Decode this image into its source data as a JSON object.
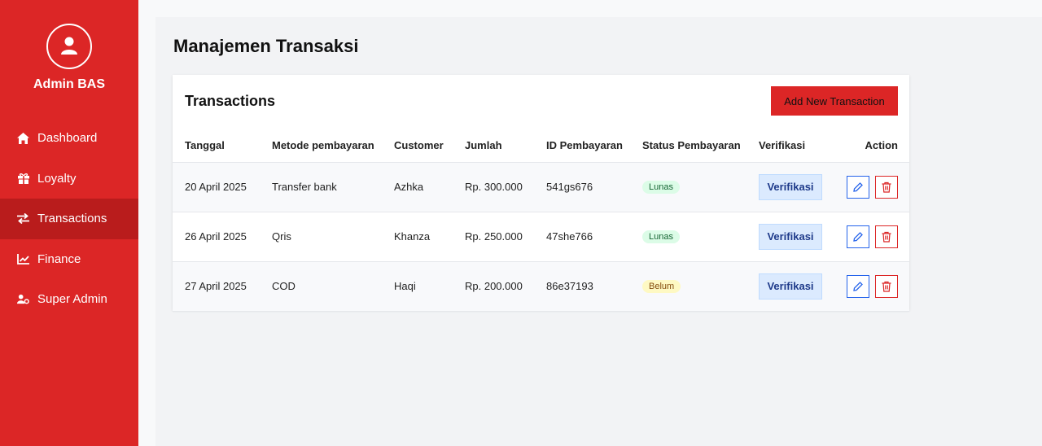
{
  "sidebar": {
    "admin_name": "Admin BAS",
    "items": [
      {
        "label": "Dashboard",
        "icon": "home-icon",
        "active": false
      },
      {
        "label": "Loyalty",
        "icon": "gift-icon",
        "active": false
      },
      {
        "label": "Transactions",
        "icon": "exchange-icon",
        "active": true
      },
      {
        "label": "Finance",
        "icon": "chart-line-icon",
        "active": false
      },
      {
        "label": "Super Admin",
        "icon": "user-gear-icon",
        "active": false
      }
    ]
  },
  "main": {
    "page_title": "Manajemen Transaksi",
    "card_title": "Transactions",
    "add_button": "Add New Transaction",
    "columns": [
      "Tanggal",
      "Metode pembayaran",
      "Customer",
      "Jumlah",
      "ID Pembayaran",
      "Status Pembayaran",
      "Verifikasi",
      "Action"
    ],
    "rows": [
      {
        "tanggal": "20 April 2025",
        "metode": "Transfer bank",
        "customer": "Azhka",
        "jumlah": "Rp. 300.000",
        "id": "541gs676",
        "status": "Lunas",
        "verify": "Verifikasi"
      },
      {
        "tanggal": "26 April 2025",
        "metode": "Qris",
        "customer": "Khanza",
        "jumlah": "Rp. 250.000",
        "id": "47she766",
        "status": "Lunas",
        "verify": "Verifikasi"
      },
      {
        "tanggal": "27 April 2025",
        "metode": "COD",
        "customer": "Haqi",
        "jumlah": "Rp. 200.000",
        "id": "86e37193",
        "status": "Belum",
        "verify": "Verifikasi"
      }
    ]
  },
  "colors": {
    "brand": "#dc2626",
    "active_nav": "#b91c1c",
    "edit": "#2563eb",
    "lunas_bg": "#dcfce7",
    "belum_bg": "#fef9c3"
  }
}
